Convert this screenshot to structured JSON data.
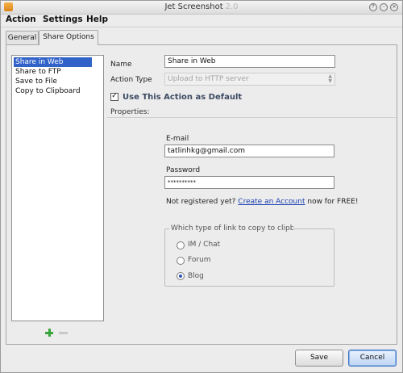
{
  "window": {
    "title": "Jet Screenshot",
    "title_faint": "2.0"
  },
  "menu": {
    "items": [
      "Action",
      "Settings",
      "Help"
    ]
  },
  "tabs": [
    {
      "label": "General",
      "active": false
    },
    {
      "label": "Share Options",
      "active": true
    }
  ],
  "actions_list": {
    "items": [
      {
        "label": "Share in Web",
        "selected": true
      },
      {
        "label": "Share to FTP",
        "selected": false
      },
      {
        "label": "Save to File",
        "selected": false
      },
      {
        "label": "Copy to Clipboard",
        "selected": false
      }
    ],
    "add_icon": "plus-icon",
    "remove_icon": "minus-icon"
  },
  "form": {
    "name_label": "Name",
    "name_value": "Share in Web",
    "action_type_label": "Action Type",
    "action_type_value": "Upload to HTTP server",
    "default_checkbox_label": "Use This Action as Default",
    "default_checked": true,
    "properties_label": "Properties:",
    "email_label": "E-mail",
    "email_value": "tatlinhkg@gmail.com",
    "password_label": "Password",
    "password_value": "**********",
    "register_prefix": "Not registered yet?",
    "register_link": "Create an Account",
    "register_suffix": "now for FREE!",
    "link_type_legend": "Which type of link to copy to clipboa",
    "link_types": [
      {
        "label": "IM / Chat",
        "checked": false
      },
      {
        "label": "Forum",
        "checked": false
      },
      {
        "label": "Blog",
        "checked": true
      }
    ]
  },
  "buttons": {
    "save": "Save",
    "cancel": "Cancel"
  },
  "colors": {
    "selection": "#3162c8",
    "link": "#1a3fb0",
    "accent_add": "#3aa53a"
  }
}
